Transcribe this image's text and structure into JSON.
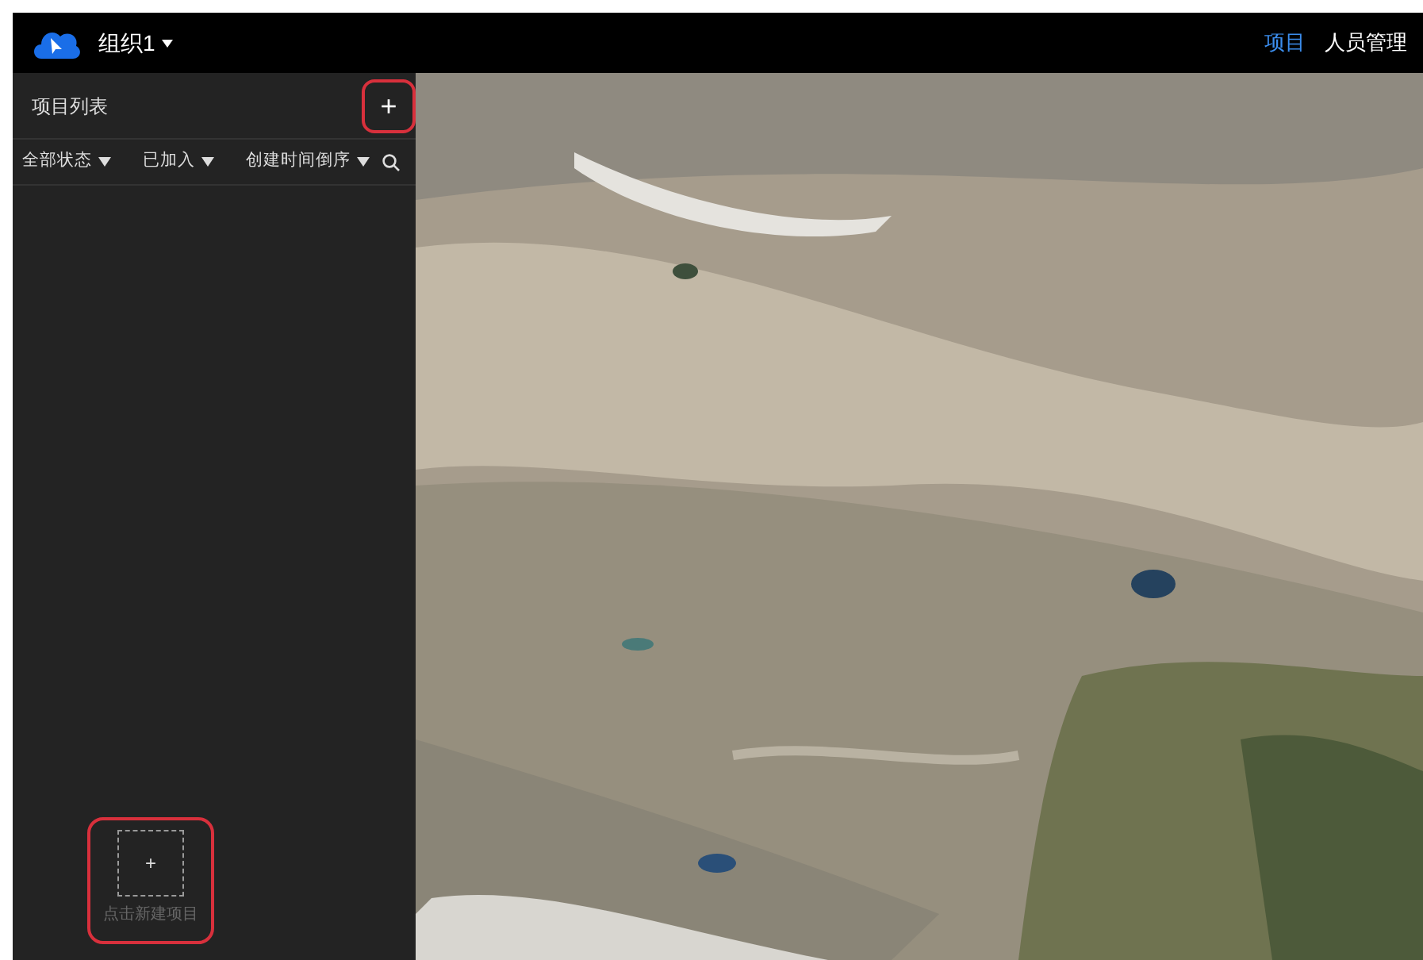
{
  "topbar": {
    "org": "组织1",
    "nav": [
      {
        "label": "项目",
        "selected": true
      },
      {
        "label": "人员管理",
        "selected": false
      }
    ]
  },
  "sidebar": {
    "title": "项目列表",
    "add_button": "+",
    "filters": [
      {
        "label": "全部状态"
      },
      {
        "label": "已加入"
      },
      {
        "label": "创建时间倒序"
      }
    ],
    "new_project": {
      "icon": "+",
      "label": "点击新建项目"
    }
  }
}
